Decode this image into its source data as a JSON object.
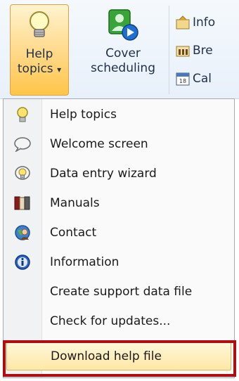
{
  "ribbon": {
    "help_topics": {
      "line1": "Help",
      "line2": "topics",
      "arrow": "▾"
    },
    "cover_scheduling": {
      "line1": "Cover",
      "line2": "scheduling"
    },
    "small_items": [
      {
        "label": "Info"
      },
      {
        "label": "Bre"
      },
      {
        "label": "Cal"
      }
    ]
  },
  "menu": {
    "items": [
      {
        "label": "Help topics",
        "icon": "lightbulb-icon"
      },
      {
        "label": "Welcome screen",
        "icon": "speech-bubble-icon"
      },
      {
        "label": "Data entry wizard",
        "icon": "wizard-bulb-icon"
      },
      {
        "label": "Manuals",
        "icon": "book-icon"
      },
      {
        "label": "Contact",
        "icon": "contact-globe-icon"
      },
      {
        "label": "Information",
        "icon": "info-icon"
      },
      {
        "label": "Create support data file",
        "icon": ""
      },
      {
        "label": "Check for updates...",
        "icon": ""
      },
      {
        "label": "Download help file",
        "icon": ""
      }
    ],
    "selected": "Download help file"
  },
  "colors": {
    "highlight_border": "#b00c12",
    "selected_bg": "#ffe8a6"
  }
}
